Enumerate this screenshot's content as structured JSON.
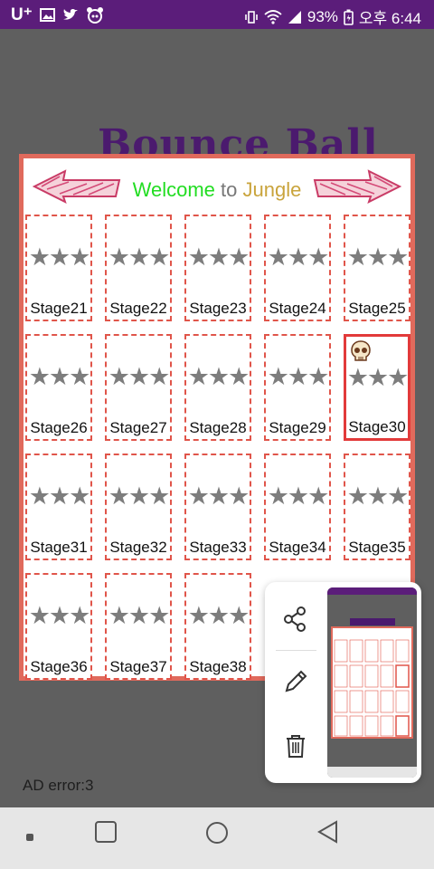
{
  "status_bar": {
    "carrier": "U⁺",
    "battery": "93%",
    "time": "오후 6:44",
    "icons": [
      "gallery-icon",
      "twitter-icon",
      "notification-icon",
      "vibrate-icon",
      "wifi-icon",
      "signal-icon",
      "battery-icon"
    ]
  },
  "app": {
    "title": "Bounce Ball",
    "welcome": {
      "word1": "Welcome",
      "word2": "to",
      "word3": "Jungle"
    },
    "colors": {
      "panel_border": "#e06a5c",
      "welcome_green": "#22dd22",
      "jungle_gold": "#c9a43c",
      "title_purple": "#4b1a6e"
    },
    "stages": [
      {
        "label": "Stage21",
        "stars": "★★★"
      },
      {
        "label": "Stage22",
        "stars": "★★★"
      },
      {
        "label": "Stage23",
        "stars": "★★★"
      },
      {
        "label": "Stage24",
        "stars": "★★★"
      },
      {
        "label": "Stage25",
        "stars": "★★★"
      },
      {
        "label": "Stage26",
        "stars": "★★★"
      },
      {
        "label": "Stage27",
        "stars": "★★★"
      },
      {
        "label": "Stage28",
        "stars": "★★★"
      },
      {
        "label": "Stage29",
        "stars": "★★★"
      },
      {
        "label": "Stage30",
        "stars": "★★★",
        "current": true
      },
      {
        "label": "Stage31",
        "stars": "★★★"
      },
      {
        "label": "Stage32",
        "stars": "★★★"
      },
      {
        "label": "Stage33",
        "stars": "★★★"
      },
      {
        "label": "Stage34",
        "stars": "★★★"
      },
      {
        "label": "Stage35",
        "stars": "★★★"
      },
      {
        "label": "Stage36",
        "stars": "★★★"
      },
      {
        "label": "Stage37",
        "stars": "★★★"
      },
      {
        "label": "Stage38",
        "stars": "★★★"
      }
    ],
    "ad_error": "AD error:3"
  },
  "screenshot_popup": {
    "actions": [
      "share-icon",
      "edit-icon",
      "delete-icon"
    ]
  },
  "nav_bar": {
    "buttons": [
      "recent-dot",
      "home-square",
      "home-circle",
      "back-triangle"
    ]
  }
}
